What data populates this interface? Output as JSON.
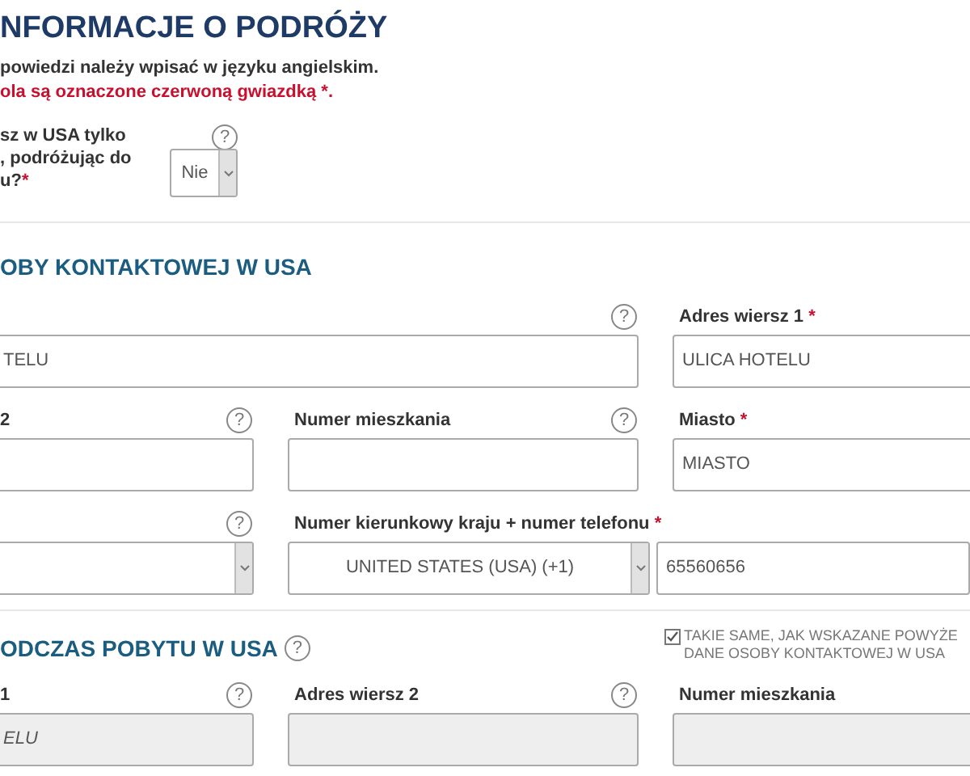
{
  "header": {
    "title": "NFORMACJE O PODRÓŻY",
    "note": "powiedzi należy wpisać w języku angielskim.",
    "required_note": "ola są oznaczone czerwoną gwiazdką *."
  },
  "question": {
    "lines": [
      "sz w USA tylko",
      ", podróżując do",
      "u?"
    ],
    "required_mark": "*",
    "help": "?",
    "select": {
      "value": "Nie"
    }
  },
  "contact": {
    "heading": "OBY KONTAKTOWEJ W USA",
    "fields": [
      {
        "kind": "wide",
        "help": "?",
        "value": "TELU",
        "disabled": false
      },
      {
        "kind": "text",
        "label": "Adres wiersz 1",
        "required_mark": "*",
        "value": "ULICA HOTELU",
        "disabled": false
      },
      {
        "kind": "text",
        "label": "2",
        "help": "?",
        "disabled": false
      },
      {
        "kind": "text",
        "label": "Numer mieszkania",
        "help": "?",
        "disabled": false
      },
      {
        "kind": "text",
        "label": "Miasto",
        "required_mark": "*",
        "value": "MIASTO",
        "disabled": false
      },
      {
        "kind": "select",
        "help": "?",
        "disabled": false
      },
      {
        "kind": "phone",
        "label": "Numer kierunkowy kraju + numer telefonu",
        "required_mark": "*",
        "value": "UNITED STATES (USA) (+1)",
        "number": "65560656",
        "disabled": false
      }
    ]
  },
  "stay": {
    "heading": "ODCZAS POBYTU W USA",
    "help": "?",
    "same_as": {
      "checked": true,
      "lines": [
        "TAKIE SAME, JAK WSKAZANE POWYŻE",
        "DANE OSOBY KONTAKTOWEJ W USA"
      ]
    },
    "fields": [
      {
        "kind": "text",
        "label": "1",
        "help": "?",
        "value": "ELU",
        "disabled": true
      },
      {
        "kind": "text",
        "label": "Adres wiersz 2",
        "help": "?",
        "disabled": true
      },
      {
        "kind": "text",
        "label": "Numer mieszkania",
        "disabled": true
      }
    ]
  }
}
